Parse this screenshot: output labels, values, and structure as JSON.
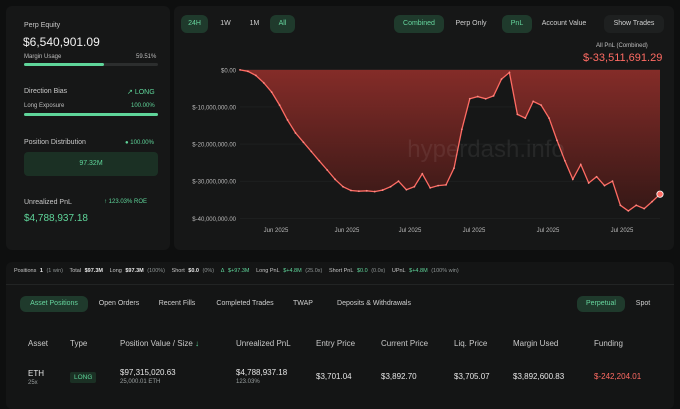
{
  "summary": {
    "perp_equity_label": "Perp Equity",
    "perp_equity_value": "$6,540,901.09",
    "margin_usage_label": "Margin Usage",
    "margin_usage_value": "59.51%",
    "margin_usage_fraction": 0.5951,
    "direction_bias_label": "Direction Bias",
    "direction_bias_value": "LONG",
    "long_exposure_label": "Long Exposure",
    "long_exposure_value": "100.00%",
    "long_exposure_fraction": 1.0,
    "position_distribution_label": "Position Distribution",
    "position_distribution_pct": "100.00%",
    "position_distribution_amount": "97.32M",
    "unrealized_pnl_label": "Unrealized PnL",
    "unrealized_pnl_roe": "123.03% ROE",
    "unrealized_pnl_value": "$4,788,937.18"
  },
  "chart_controls": {
    "ranges": [
      "24H",
      "1W",
      "1M",
      "All"
    ],
    "active_range": "All",
    "modes": [
      "Combined",
      "Perp Only"
    ],
    "active_mode": "Combined",
    "metrics": [
      "PnL",
      "Account Value"
    ],
    "active_metric": "PnL",
    "show_trades": "Show Trades"
  },
  "chart_header": {
    "label": "All PnL (Combined)",
    "value": "$-33,511,691.29"
  },
  "watermark": "hyperdash.info",
  "chart_data": {
    "type": "area",
    "title": "All PnL (Combined)",
    "y_ticks": [
      "$0.00",
      "$-10,000,000.00",
      "$-20,000,000.00",
      "$-30,000,000.00",
      "$-40,000,000.00"
    ],
    "x_ticks": [
      "Jun 2025",
      "Jun 2025",
      "Jul 2025",
      "Jul 2025",
      "Jul 2025",
      "Jul 2025"
    ],
    "ylim": [
      -41000000,
      500000
    ],
    "series": [
      {
        "values": [
          0,
          -400000,
          -1500000,
          -3500000,
          -6000000,
          -9500000,
          -13500000,
          -17000000,
          -19500000,
          -22000000,
          -24500000,
          -27000000,
          -29500000,
          -31500000,
          -32500000,
          -32700000,
          -32600000,
          -32800000,
          -32400000,
          -31500000,
          -30000000,
          -32300000,
          -31500000,
          -28000000,
          -31800000,
          -31200000,
          -31000000,
          -26500000,
          -16000000,
          -7800000,
          -7200000,
          -7800000,
          -7000000,
          -2500000,
          -700000,
          -12000000,
          -13000000,
          -8500000,
          -9500000,
          -13000000,
          -19000000,
          -24500000,
          -29500000,
          -25500000,
          -30500000,
          -28800000,
          -31200000,
          -30000000,
          -36500000,
          -38000000,
          -36500000,
          -37400000,
          -35500000,
          -33500000
        ]
      }
    ],
    "line_color": "#ff6b63",
    "fill_color": "#7a2a27",
    "end_marker": "$-33,511,691.29"
  },
  "stats_strip": {
    "positions_label": "Positions",
    "positions_value": "1",
    "positions_note": "(1 win)",
    "total_label": "Total",
    "total_value": "$97.3M",
    "long_label": "Long",
    "long_value": "$97.3M",
    "long_note": "(100%)",
    "short_label": "Short",
    "short_value": "$0.0",
    "short_note": "(0%)",
    "delta_label": "Δ",
    "delta_value": "$+97.3M",
    "long_pnl_label": "Long PnL",
    "long_pnl_value": "$+4.8M",
    "long_pnl_note": "(25.0x)",
    "short_pnl_label": "Short PnL",
    "short_pnl_value": "$0.0",
    "short_pnl_note": "(0.0x)",
    "upnl_label": "UPnL",
    "upnl_value": "$+4.8M",
    "upnl_note": "(100% win)"
  },
  "tabs": {
    "items": [
      "Asset Positions",
      "Open Orders",
      "Recent Fills",
      "Completed Trades",
      "TWAP",
      "Deposits & Withdrawals"
    ],
    "active": "Asset Positions",
    "market_types": [
      "Perpetual",
      "Spot"
    ],
    "active_market": "Perpetual"
  },
  "table": {
    "headers": [
      "Asset",
      "Type",
      "Position Value / Size",
      "Unrealized PnL",
      "Entry Price",
      "Current Price",
      "Liq. Price",
      "Margin Used",
      "Funding"
    ],
    "sort_arrow": "↓",
    "rows": [
      {
        "asset": "ETH",
        "leverage": "25x",
        "type": "LONG",
        "position_value": "$97,315,020.63",
        "position_size": "25,000.01 ETH",
        "unrealized_pnl": "$4,788,937.18",
        "unrealized_pnl_pct": "123.03%",
        "entry_price": "$3,701.04",
        "current_price": "$3,892.70",
        "liq_price": "$3,705.07",
        "margin_used": "$3,892,600.83",
        "funding": "$-242,204.01"
      }
    ]
  },
  "colors": {
    "accent_green": "#5fd59a",
    "negative_red": "#ff6b63",
    "background": "#0e0f0f"
  }
}
